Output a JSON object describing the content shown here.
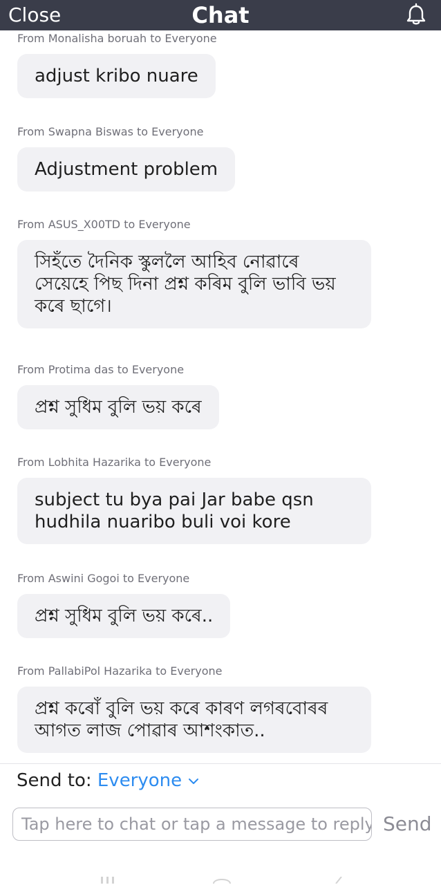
{
  "header": {
    "close_label": "Close",
    "title": "Chat"
  },
  "messages": [
    {
      "sender": "From Monalisha boruah to Everyone",
      "lines": [
        "adjust kribo nuare"
      ]
    },
    {
      "sender": "From Swapna Biswas to Everyone",
      "lines": [
        "Adjustment problem"
      ]
    },
    {
      "sender": "From ASUS_X00TD to Everyone",
      "lines": [
        "সিহঁতে দৈনিক স্কুললৈ আহিব নোৱাৰে",
        "সেয়েহে পিছ দিনা প্ৰশ্ন কৰিম বুলি ভাবি ভয়",
        "কৰে ছাগে।"
      ]
    },
    {
      "sender": "From Protima das to Everyone",
      "lines": [
        "প্ৰশ্ন সুধিম বুলি ভয় কৰে"
      ]
    },
    {
      "sender": "From Lobhita Hazarika to Everyone",
      "lines": [
        "subject tu bya pai Jar babe qsn",
        "hudhila nuaribo buli voi kore"
      ]
    },
    {
      "sender": "From Aswini Gogoi to Everyone",
      "lines": [
        "প্ৰশ্ন সুধিম বুলি ভয় কৰে.."
      ]
    },
    {
      "sender": "From PallabiPol Hazarika to Everyone",
      "lines": [
        "প্ৰশ্ন কৰোঁ বুলি ভয় কৰে কাৰণ লগৰবোৰৰ",
        "আগত লাজ পোৱাৰ আশংকাত.."
      ]
    }
  ],
  "composer": {
    "send_to_label": "Send to:",
    "recipient": "Everyone",
    "placeholder": "Tap here to chat or tap a message to reply",
    "send_label": "Send"
  },
  "colors": {
    "header_bg": "#3a3d4a",
    "accent": "#2d8cf0",
    "bubble_bg": "#f1f1f4"
  },
  "icons": {
    "bell": "bell-icon",
    "chevron": "chevron-down-icon"
  }
}
